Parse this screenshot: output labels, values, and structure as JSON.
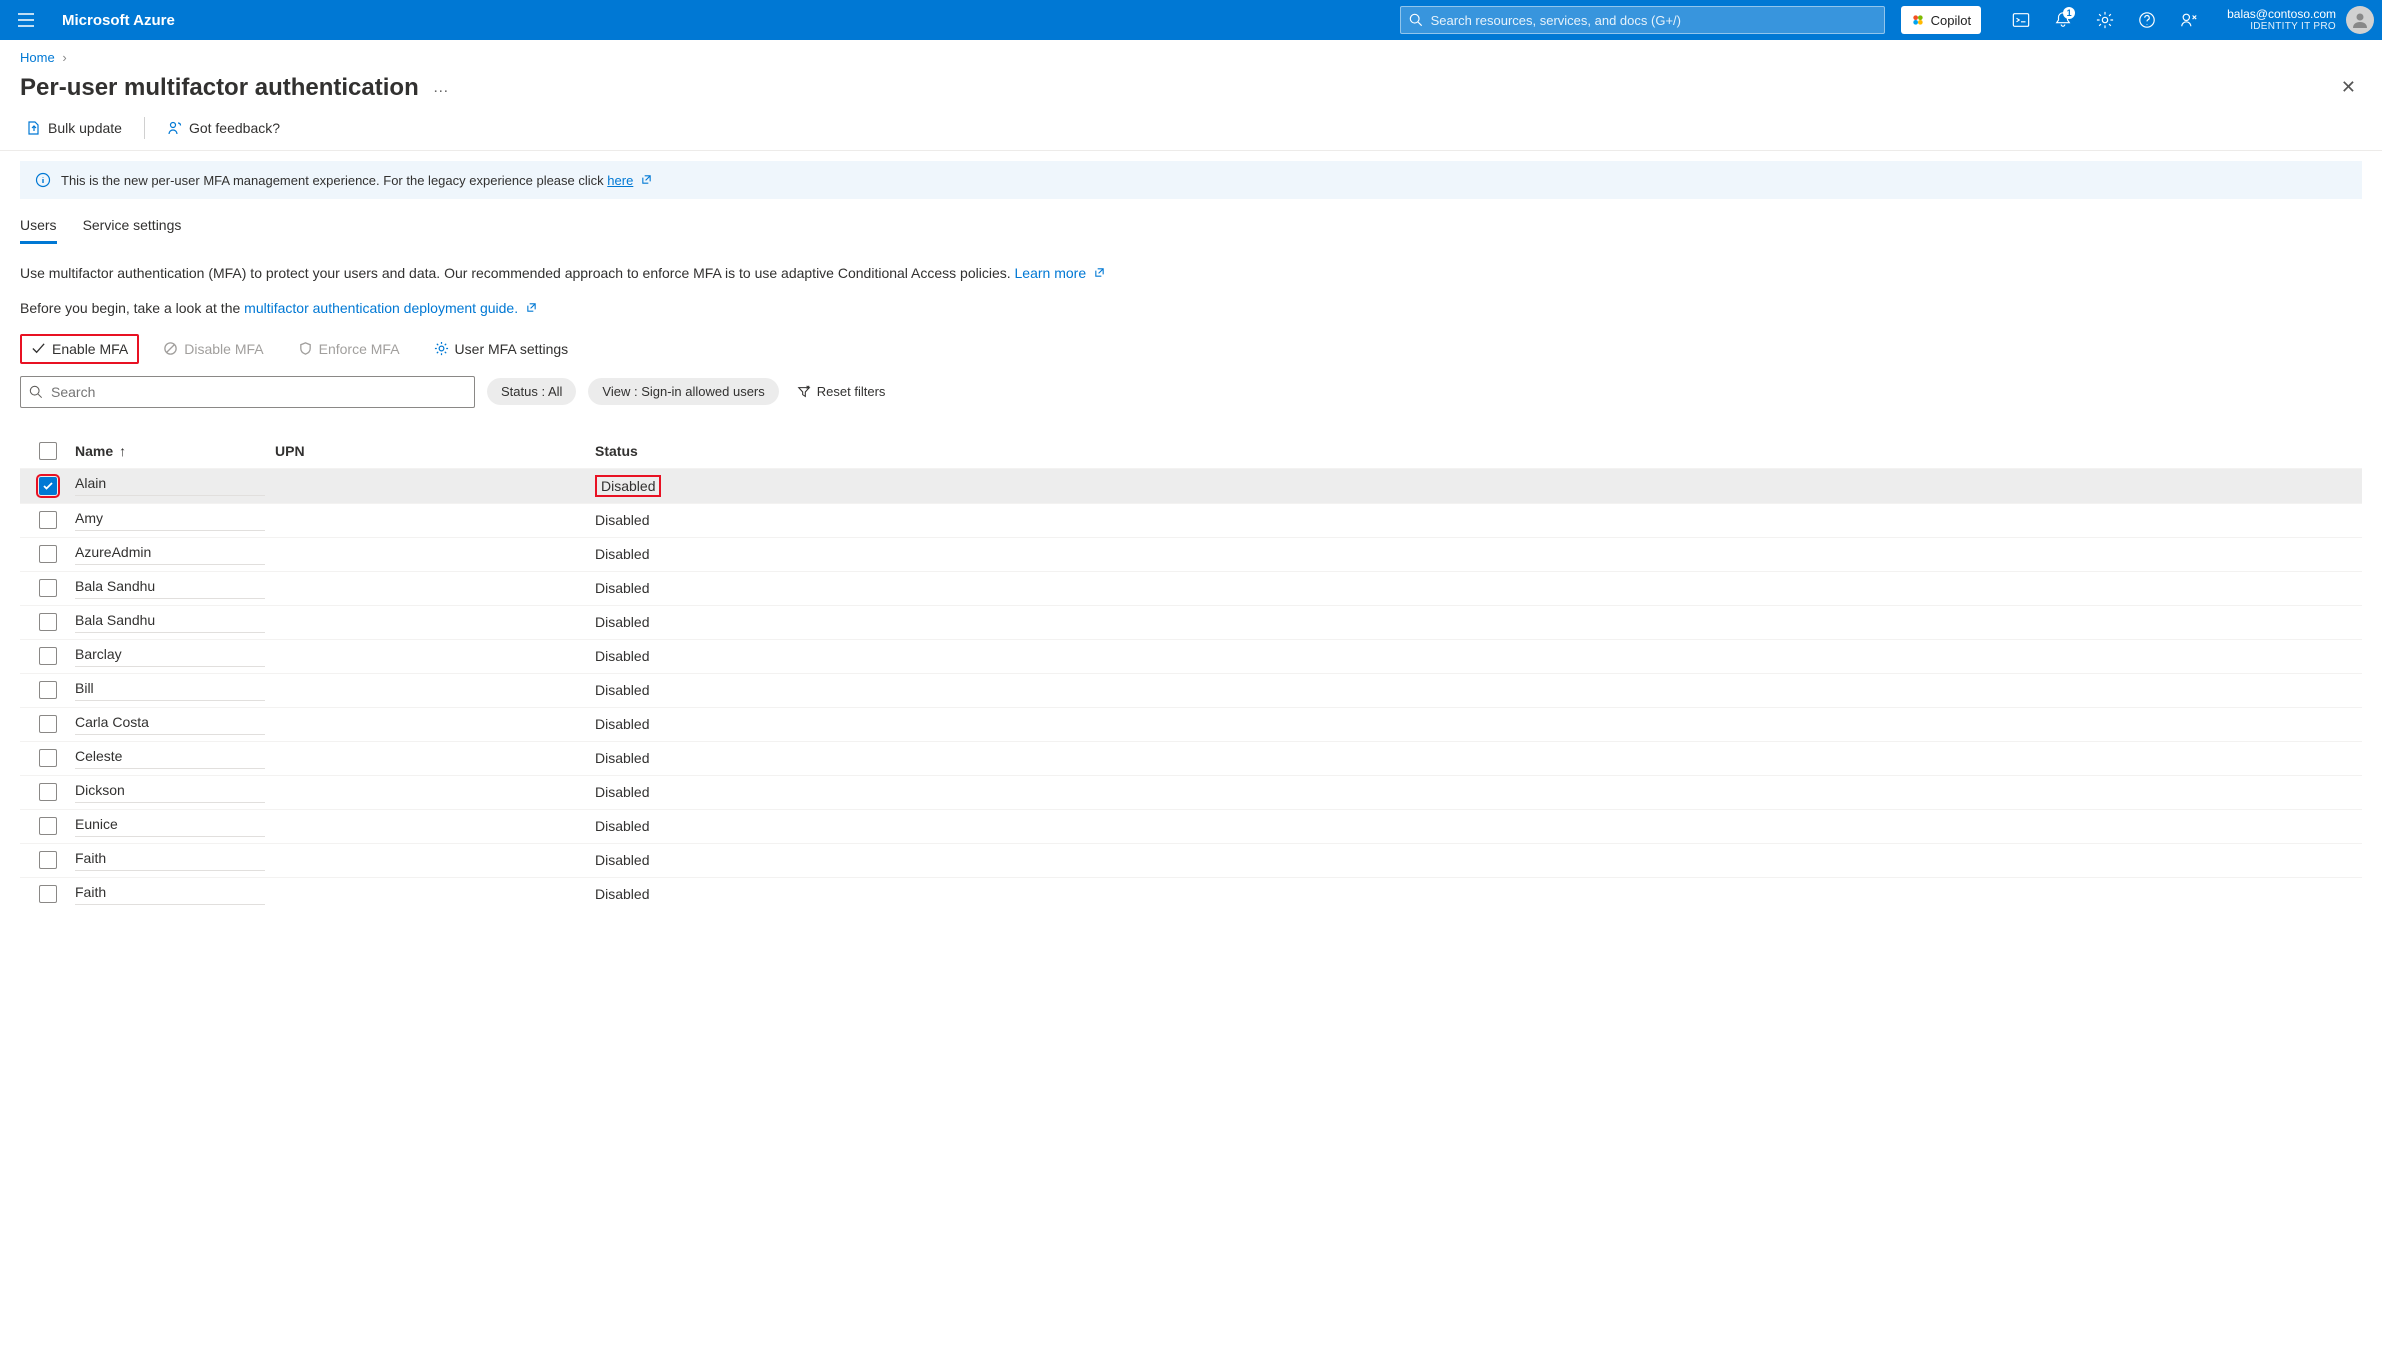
{
  "header": {
    "brand": "Microsoft Azure",
    "search_placeholder": "Search resources, services, and docs (G+/)",
    "copilot_label": "Copilot",
    "notification_count": "1",
    "account_email": "balas@contoso.com",
    "account_sub": "IDENTITY IT PRO"
  },
  "breadcrumb": {
    "home": "Home"
  },
  "page": {
    "title": "Per-user multifactor authentication"
  },
  "toolbar": {
    "bulk_update": "Bulk update",
    "got_feedback": "Got feedback?"
  },
  "banner": {
    "text": "This is the new per-user MFA management experience. For the legacy experience please click ",
    "link": "here"
  },
  "tabs": {
    "users": "Users",
    "service_settings": "Service settings"
  },
  "desc": {
    "line1a": "Use multifactor authentication (MFA) to protect your users and data. Our recommended approach to enforce MFA is to use adaptive Conditional Access policies. ",
    "learn_more": "Learn more",
    "line2a": "Before you begin, take a look at the ",
    "guide_link": "multifactor authentication deployment guide."
  },
  "commands": {
    "enable": "Enable MFA",
    "disable": "Disable MFA",
    "enforce": "Enforce MFA",
    "settings": "User MFA settings"
  },
  "filters": {
    "search_placeholder": "Search",
    "status_pill": "Status : All",
    "view_pill": "View : Sign-in allowed users",
    "reset": "Reset filters"
  },
  "table": {
    "head": {
      "name": "Name",
      "upn": "UPN",
      "status": "Status"
    },
    "rows": [
      {
        "name": "Alain",
        "upn": "",
        "status": "Disabled",
        "selected": true
      },
      {
        "name": "Amy",
        "upn": "",
        "status": "Disabled",
        "selected": false
      },
      {
        "name": "AzureAdmin",
        "upn": "",
        "status": "Disabled",
        "selected": false
      },
      {
        "name": "Bala Sandhu",
        "upn": "",
        "status": "Disabled",
        "selected": false
      },
      {
        "name": "Bala Sandhu",
        "upn": "",
        "status": "Disabled",
        "selected": false
      },
      {
        "name": "Barclay",
        "upn": "",
        "status": "Disabled",
        "selected": false
      },
      {
        "name": "Bill",
        "upn": "",
        "status": "Disabled",
        "selected": false
      },
      {
        "name": "Carla Costa",
        "upn": "",
        "status": "Disabled",
        "selected": false
      },
      {
        "name": "Celeste",
        "upn": "",
        "status": "Disabled",
        "selected": false
      },
      {
        "name": "Dickson",
        "upn": "",
        "status": "Disabled",
        "selected": false
      },
      {
        "name": "Eunice",
        "upn": "",
        "status": "Disabled",
        "selected": false
      },
      {
        "name": "Faith",
        "upn": "",
        "status": "Disabled",
        "selected": false
      },
      {
        "name": "Faith",
        "upn": "",
        "status": "Disabled",
        "selected": false
      }
    ]
  }
}
